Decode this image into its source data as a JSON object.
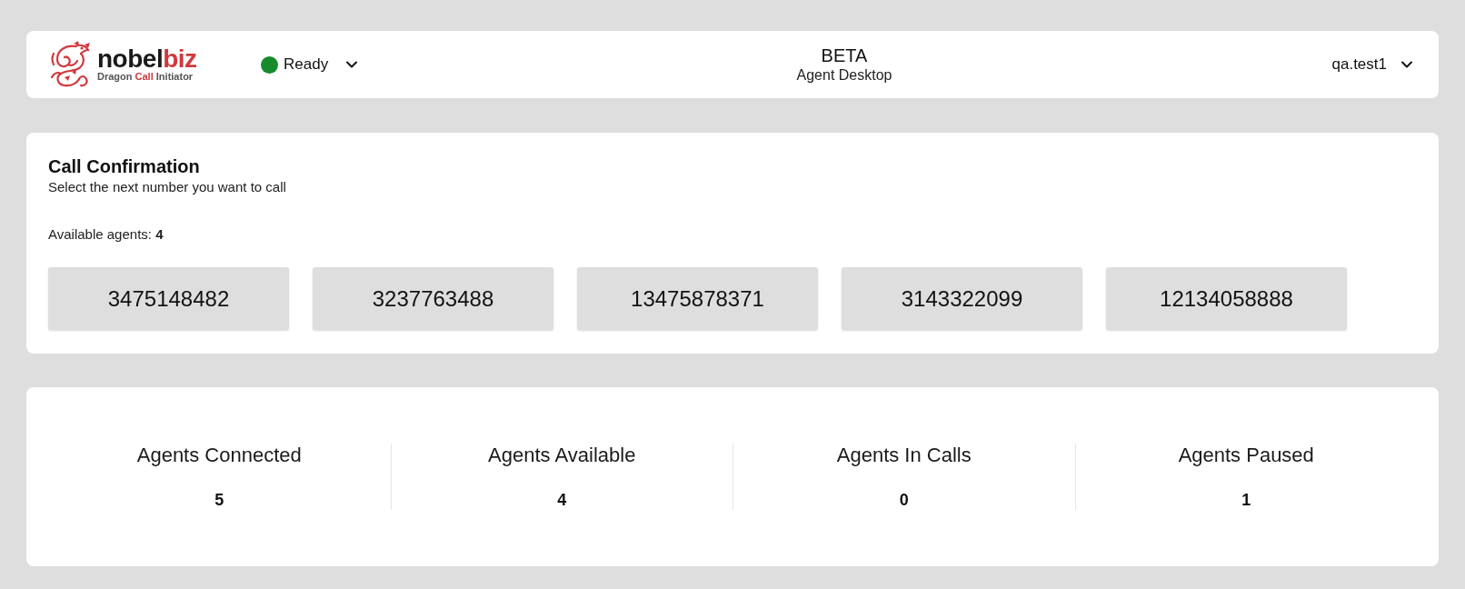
{
  "header": {
    "logo": {
      "wordmark": [
        {
          "text": "nobel",
          "accent": false
        },
        {
          "text": "biz",
          "accent": true
        }
      ],
      "tagline": [
        {
          "text": "Dragon ",
          "accent": false
        },
        {
          "text": "Call",
          "accent": true
        },
        {
          "text": " Initiator",
          "accent": false
        }
      ]
    },
    "status": {
      "label": "Ready",
      "color": "#178a2c"
    },
    "title": "BETA",
    "subtitle": "Agent Desktop",
    "user": "qa.test1"
  },
  "call_confirmation": {
    "title": "Call Confirmation",
    "subtitle": "Select the next number you want to call",
    "available_agents": "Available agents: **4**",
    "numbers": [
      "3475148482",
      "3237763488",
      "13475878371",
      "3143322099",
      "12134058888"
    ]
  },
  "stats": [
    {
      "label": "Agents Connected",
      "value": "5"
    },
    {
      "label": "Agents Available",
      "value": "4"
    },
    {
      "label": "Agents In Calls",
      "value": "0"
    },
    {
      "label": "Agents Paused",
      "value": "1"
    }
  ]
}
